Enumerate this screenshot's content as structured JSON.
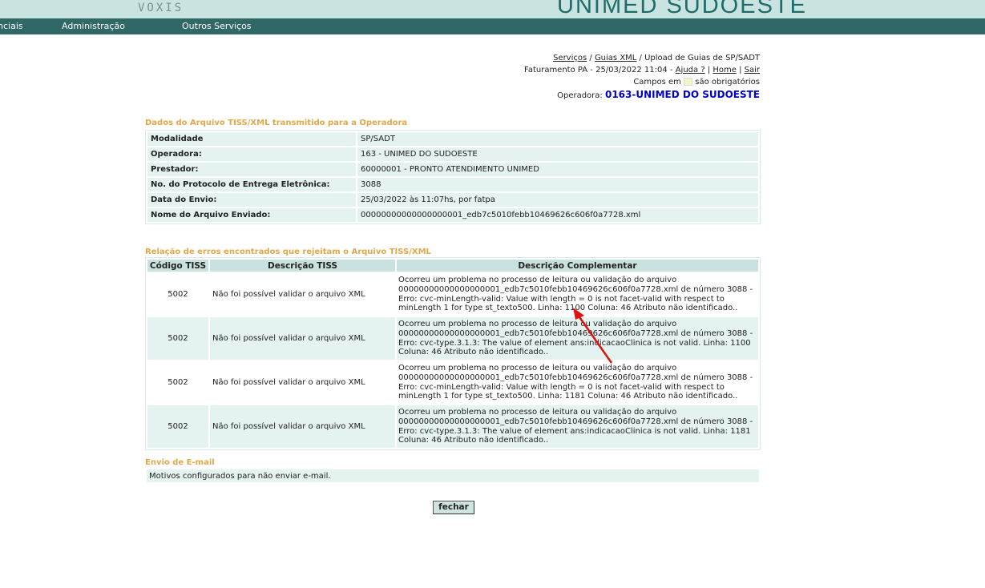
{
  "header": {
    "voxis": "VOXIS",
    "brand": "UNIMED SUDOESTE",
    "menu": [
      "nciais",
      "Administração",
      "Outros Serviços"
    ]
  },
  "breadcrumb": {
    "items": [
      "Serviços",
      "Guias XML"
    ],
    "current": "Upload de Guias de SP/SADT",
    "sep": " / "
  },
  "user_line": {
    "text": "Faturamento PA - 25/03/2022 11:04 - ",
    "help": "Ajuda ?",
    "home": "Home",
    "exit": "Sair",
    "pipe": " | "
  },
  "required_note": {
    "prefix": "Campos em ",
    "suffix": " são obrigatórios"
  },
  "operadora": {
    "label": "Operadora: ",
    "name": "0163-UNIMED DO SUDOESTE"
  },
  "dados": {
    "title": "Dados do Arquivo TISS/XML transmitido para a Operadora",
    "rows": [
      {
        "label": "Modalidade",
        "value": "SP/SADT"
      },
      {
        "label": "Operadora:",
        "value": "163 - UNIMED DO SUDOESTE"
      },
      {
        "label": "Prestador:",
        "value": "60000001 - PRONTO ATENDIMENTO UNIMED"
      },
      {
        "label": "No. do Protocolo de Entrega Eletrônica:",
        "value": "3088"
      },
      {
        "label": "Data do Envio:",
        "value": "25/03/2022 às 11:07hs, por fatpa"
      },
      {
        "label": "Nome do Arquivo Enviado:",
        "value": "00000000000000000001_edb7c5010febb10469626c606f0a7728.xml"
      }
    ]
  },
  "erros": {
    "title": "Relação de erros encontrados que rejeitam o Arquivo TISS/XML",
    "headers": [
      "Código TISS",
      "Descrição TISS",
      "Descrição Complementar"
    ],
    "rows": [
      {
        "code": "5002",
        "desc": "Não foi possível validar o arquivo XML",
        "comp": "Ocorreu um problema no processo de leitura ou validação do arquivo 00000000000000000001_edb7c5010febb10469626c606f0a7728.xml de número 3088 - Erro: cvc-minLength-valid: Value with length = 0 is not facet-valid with respect to minLength 1 for type st_texto500. Linha: 1100 Coluna: 46 Atributo não identificado.."
      },
      {
        "code": "5002",
        "desc": "Não foi possível validar o arquivo XML",
        "comp": "Ocorreu um problema no processo de leitura ou validação do arquivo 00000000000000000001_edb7c5010febb10469626c606f0a7728.xml de número 3088 - Erro: cvc-type.3.1.3: The value of element ans:indicacaoClinica is not valid. Linha: 1100 Coluna: 46 Atributo não identificado.."
      },
      {
        "code": "5002",
        "desc": "Não foi possível validar o arquivo XML",
        "comp": "Ocorreu um problema no processo de leitura ou validação do arquivo 00000000000000000001_edb7c5010febb10469626c606f0a7728.xml de número 3088 - Erro: cvc-minLength-valid: Value with length = 0 is not facet-valid with respect to minLength 1 for type st_texto500. Linha: 1181 Coluna: 46 Atributo não identificado.."
      },
      {
        "code": "5002",
        "desc": "Não foi possível validar o arquivo XML",
        "comp": "Ocorreu um problema no processo de leitura ou validação do arquivo 00000000000000000001_edb7c5010febb10469626c606f0a7728.xml de número 3088 - Erro: cvc-type.3.1.3: The value of element ans:indicacaoClinica is not valid. Linha: 1181 Coluna: 46 Atributo não identificado.."
      }
    ]
  },
  "email": {
    "title": "Envio de E-mail",
    "text": "Motivos configurados para não enviar e-mail."
  },
  "close_button": "fechar",
  "colors": {
    "menubar": "#2f6867",
    "topbar": "#c8e3e0",
    "section_title": "#e0a84a",
    "operadora_name": "#0000cc",
    "annotation_arrow": "#e01010"
  }
}
